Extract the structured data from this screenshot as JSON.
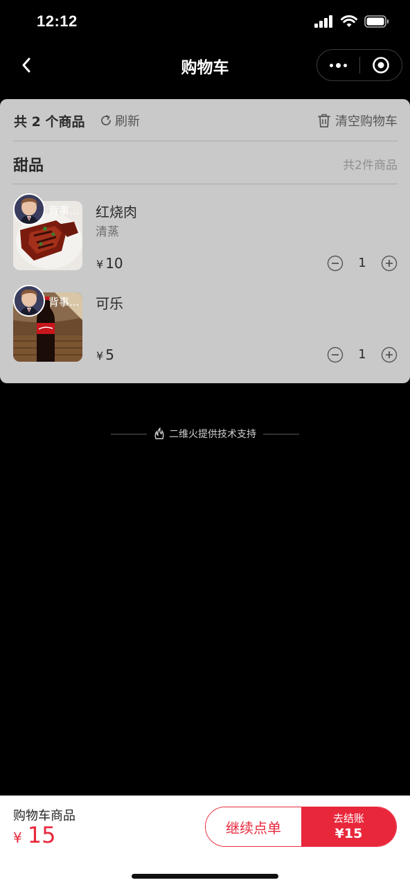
{
  "status_bar": {
    "time": "12:12"
  },
  "nav": {
    "title": "购物车"
  },
  "cart": {
    "item_count": "共 2 个商品",
    "refresh_label": "刷新",
    "clear_label": "清空购物车",
    "category": {
      "name": "甜品",
      "count": "共2件商品"
    },
    "products": [
      {
        "name": "红烧肉",
        "spec": "清蒸",
        "yen": "¥",
        "price": "10",
        "qty": "1",
        "avatar_label": "背事..."
      },
      {
        "name": "可乐",
        "spec": "",
        "yen": "¥",
        "price": "5",
        "qty": "1",
        "avatar_label": "背事..."
      }
    ]
  },
  "brand": {
    "text": "二维火提供技术支持"
  },
  "bottom": {
    "total_label": "购物车商品",
    "total_yen": "¥",
    "total_value": "15",
    "continue_label": "继续点单",
    "checkout_label": "去结账",
    "checkout_price": "¥15"
  },
  "colors": {
    "accent": "#e8273b",
    "card_bg": "#c9c9c9",
    "page_bg": "#000000"
  }
}
